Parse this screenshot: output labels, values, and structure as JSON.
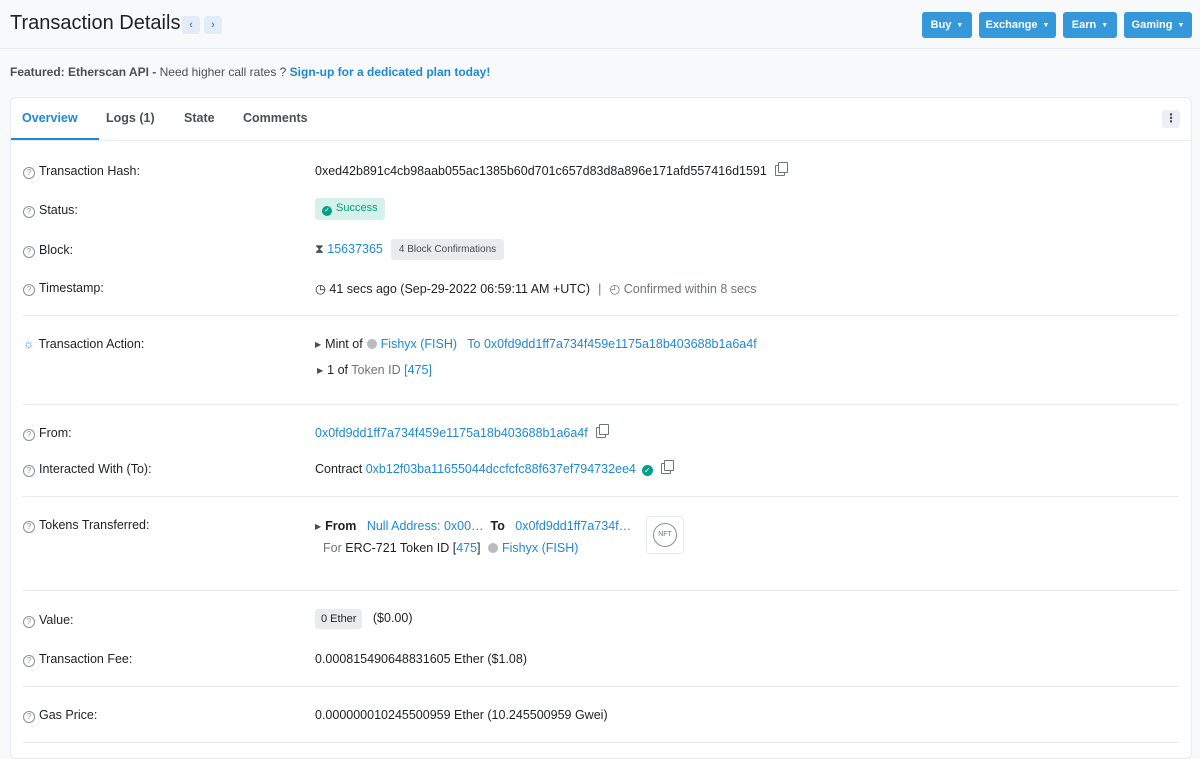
{
  "header": {
    "title": "Transaction Details",
    "prev_arrow": "‹",
    "next_arrow": "›",
    "buttons": [
      "Buy",
      "Exchange",
      "Earn",
      "Gaming"
    ]
  },
  "featured": {
    "bold": "Featured: Etherscan API -",
    "text": " Need higher call rates ? ",
    "link": "Sign-up for a dedicated plan today!"
  },
  "tabs": [
    "Overview",
    "Logs (1)",
    "State",
    "Comments"
  ],
  "rows": {
    "hash": {
      "label": "Transaction Hash:",
      "value": "0xed42b891c4cb98aab055ac1385b60d701c657d83d8a896e171afd557416d1591"
    },
    "status": {
      "label": "Status:",
      "value": "Success"
    },
    "block": {
      "label": "Block:",
      "value": "15637365",
      "confirmations": "4 Block Confirmations"
    },
    "timestamp": {
      "label": "Timestamp:",
      "value": "41 secs ago (Sep-29-2022 06:59:11 AM +UTC)",
      "sep": "|",
      "confirmed": "Confirmed within 8 secs"
    },
    "action": {
      "label": "Transaction Action:",
      "line1_prefix": "Mint of",
      "token": "Fishyx (FISH)",
      "to_label": "To",
      "to_address": "0x0fd9dd1ff7a734f459e1175a18b403688b1a6a4f",
      "line2_prefix": "1 of",
      "token_id_label": "Token ID",
      "token_id_open": "[",
      "token_id": "475",
      "token_id_close": "]"
    },
    "from": {
      "label": "From:",
      "value": "0x0fd9dd1ff7a734f459e1175a18b403688b1a6a4f"
    },
    "to": {
      "label": "Interacted With (To):",
      "prefix": "Contract",
      "value": "0xb12f03ba11655044dccfcfc88f637ef794732ee4"
    },
    "tokens": {
      "label": "Tokens Transferred:",
      "from_label": "From",
      "from_value": "Null Address: 0x00…",
      "to_label": "To",
      "to_value": "0x0fd9dd1ff7a734f…",
      "for_label": "For",
      "erc_label": "ERC-721 Token ID",
      "token_id": "475",
      "token": "Fishyx (FISH)",
      "nft_label": "NFT"
    },
    "value": {
      "label": "Value:",
      "badge": "0 Ether",
      "usd": "($0.00)"
    },
    "fee": {
      "label": "Transaction Fee:",
      "value": "0.000815490648831605 Ether ($1.08)"
    },
    "gas": {
      "label": "Gas Price:",
      "value": "0.000000010245500959 Ether (10.245500959 Gwei)"
    }
  }
}
